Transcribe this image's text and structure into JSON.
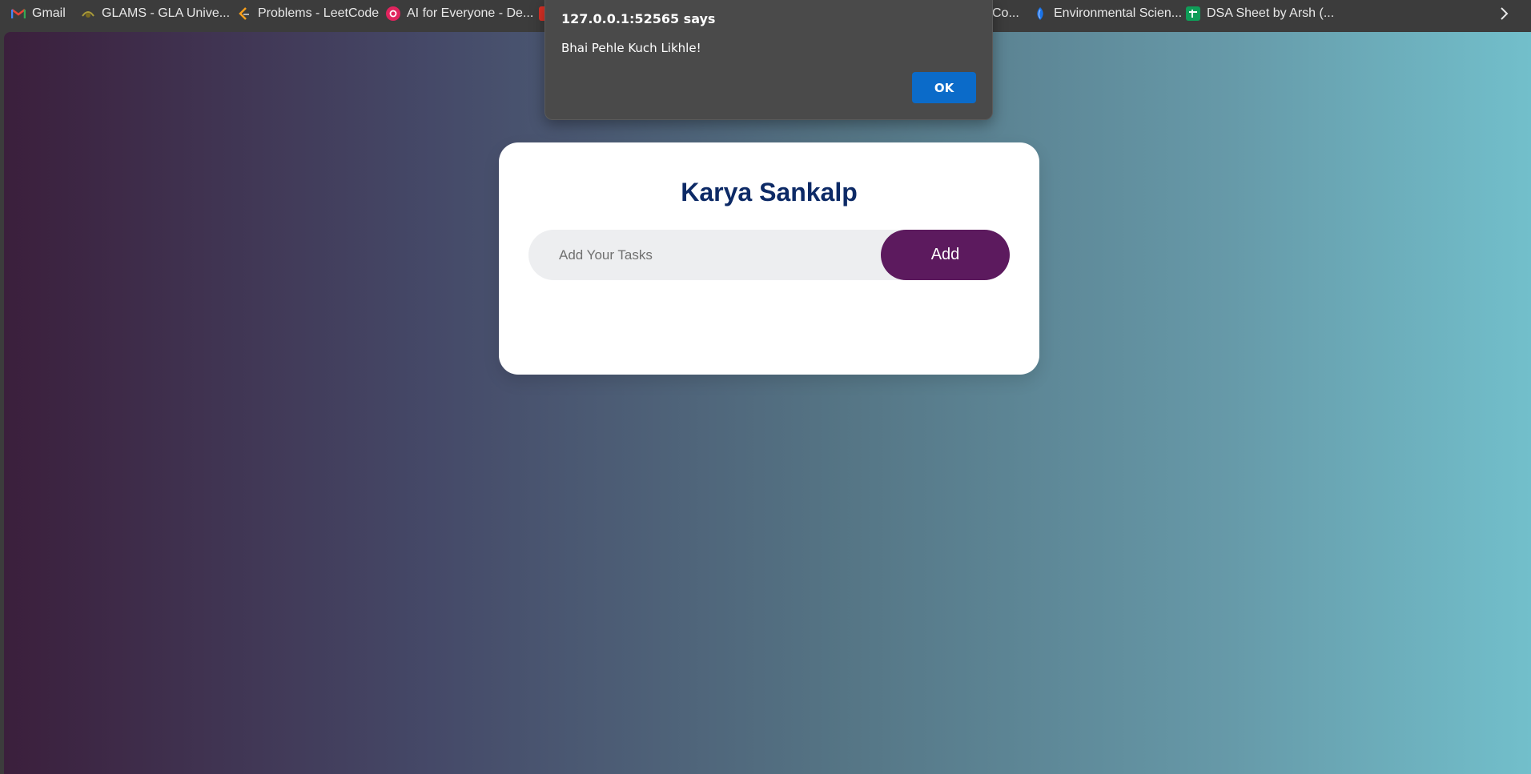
{
  "bookmarks": [
    {
      "label": "Gmail",
      "icon": "gmail-icon",
      "color": "#ea4335"
    },
    {
      "label": "GLAMS - GLA Unive...",
      "icon": "glams-icon",
      "color": "#8a7a2a"
    },
    {
      "label": "Problems - LeetCode",
      "icon": "leetcode-icon",
      "color": "#f89f1b"
    },
    {
      "label": "AI for Everyone - De...",
      "icon": "coursera-icon",
      "color": "#e0245e"
    },
    {
      "label": "Co...",
      "icon": "bookmark-icon",
      "color": "#d93025"
    },
    {
      "label": "Environmental Scien...",
      "icon": "environment-icon",
      "color": "#1a73e8"
    },
    {
      "label": "DSA Sheet by Arsh (...",
      "icon": "sheets-icon",
      "color": "#0f9d58"
    }
  ],
  "app": {
    "title": "Karya Sankalp",
    "input_placeholder": "Add Your Tasks",
    "add_label": "Add"
  },
  "alert": {
    "title": "127.0.0.1:52565 says",
    "message": "Bhai Pehle Kuch Likhle!",
    "ok_label": "OK"
  },
  "colors": {
    "title": "#0d2a66",
    "add_button": "#5c1a5e",
    "alert_ok": "#0b6bc9"
  }
}
